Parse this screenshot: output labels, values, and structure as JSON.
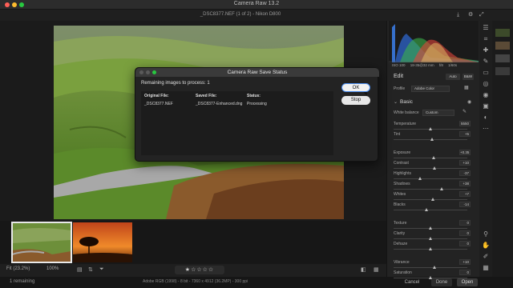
{
  "window": {
    "title": "Camera Raw 13.2",
    "colors": {
      "close": "#ff5f57",
      "minimize": "#febc2e",
      "maximize": "#28c840"
    }
  },
  "header": {
    "file_info": "_DSC8377.NEF (1 of 2)  -  Nikon D800"
  },
  "filmstrip": {
    "thumbnails": [
      {
        "name": "green valley road",
        "selected": true
      },
      {
        "name": "sunset tree",
        "selected": false
      }
    ]
  },
  "bottom_bar": {
    "fit_label": "Fit (23.2%)",
    "zoom_label": "100%",
    "rating_stars": "★☆☆☆☆"
  },
  "status_bar": {
    "left_text": "1 remaining",
    "mid_text": "Adobe RGB (1998) - 8 bit - 7360 x 4912 (36.2MP) - 300 ppi",
    "cancel_label": "Cancel",
    "done_label": "Done",
    "open_label": "Open"
  },
  "histogram_info": {
    "iso": "ISO 100",
    "focal": "18-35@32 mm",
    "fstop": "f/8",
    "shutter": "1/60s"
  },
  "edit_panel": {
    "edit_label": "Edit",
    "auto_label": "Auto",
    "bw_label": "B&W",
    "profile_label": "Profile",
    "profile_value": "Adobe Color",
    "basic_label": "Basic",
    "white_balance_label": "White balance",
    "white_balance_value": "Custom",
    "sliders": [
      {
        "label": "Temperature",
        "value": "5550",
        "position": 0.5
      },
      {
        "label": "Tint",
        "value": "+5",
        "position": 0.52
      },
      {
        "label": "Exposure",
        "value": "+0.35",
        "position": 0.54
      },
      {
        "label": "Contrast",
        "value": "+10",
        "position": 0.55
      },
      {
        "label": "Highlights",
        "value": "-37",
        "position": 0.36
      },
      {
        "label": "Shadows",
        "value": "+38",
        "position": 0.65
      },
      {
        "label": "Whites",
        "value": "+7",
        "position": 0.53
      },
      {
        "label": "Blacks",
        "value": "-14",
        "position": 0.45
      },
      {
        "label": "Texture",
        "value": "0",
        "position": 0.5
      },
      {
        "label": "Clarity",
        "value": "0",
        "position": 0.5
      },
      {
        "label": "Dehaze",
        "value": "0",
        "position": 0.5
      },
      {
        "label": "Vibrance",
        "value": "+10",
        "position": 0.55
      },
      {
        "label": "Saturation",
        "value": "0",
        "position": 0.5
      }
    ]
  },
  "dialog": {
    "title": "Camera Raw Save Status",
    "remaining": "Remaining images to process:  1",
    "col_original": "Original File:",
    "col_saved": "Saved File:",
    "col_status": "Status:",
    "row_original": "_DSC8377.NEF",
    "row_saved": "_DSC8377-Enhanced.dng",
    "row_status": "Processing",
    "ok_label": "OK",
    "stop_label": "Stop"
  }
}
